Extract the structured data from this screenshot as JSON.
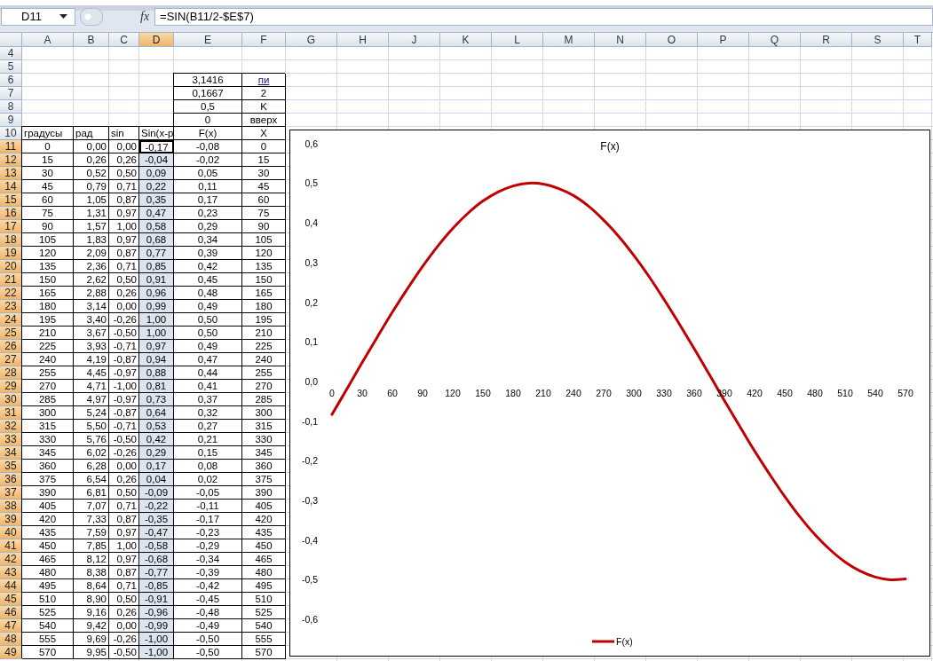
{
  "formula_bar": {
    "name_box": "D11",
    "function_label": "fx",
    "formula": "=SIN(B11/2-$E$7)"
  },
  "sheet": {
    "columns": [
      {
        "label": "A",
        "selected": false
      },
      {
        "label": "B",
        "selected": false
      },
      {
        "label": "C",
        "selected": false
      },
      {
        "label": "D",
        "selected": true
      },
      {
        "label": "E",
        "selected": false
      },
      {
        "label": "F",
        "selected": false
      },
      {
        "label": "G",
        "selected": false
      },
      {
        "label": "H",
        "selected": false
      },
      {
        "label": "J",
        "selected": false
      },
      {
        "label": "K",
        "selected": false
      },
      {
        "label": "L",
        "selected": false
      },
      {
        "label": "M",
        "selected": false
      },
      {
        "label": "N",
        "selected": false
      },
      {
        "label": "O",
        "selected": false
      },
      {
        "label": "P",
        "selected": false
      },
      {
        "label": "Q",
        "selected": false
      },
      {
        "label": "R",
        "selected": false
      },
      {
        "label": "S",
        "selected": false
      },
      {
        "label": "T",
        "selected": false
      }
    ],
    "rows": [
      {
        "number": "4",
        "kind": "blank",
        "selected": false
      },
      {
        "number": "5",
        "kind": "blank",
        "selected": false
      },
      {
        "number": "6",
        "kind": "param",
        "selected": false,
        "e": "3,1416",
        "f": "пи",
        "f_underlined": true
      },
      {
        "number": "7",
        "kind": "param",
        "selected": false,
        "e": "0,1667",
        "f": "2",
        "f_underlined": false
      },
      {
        "number": "8",
        "kind": "param",
        "selected": false,
        "e": "0,5",
        "f": "K",
        "f_underlined": false
      },
      {
        "number": "9",
        "kind": "param",
        "selected": false,
        "e": "0",
        "f": "вверх",
        "f_underlined": false
      },
      {
        "number": "10",
        "kind": "header",
        "selected": false,
        "values": [
          "градусы",
          "рад",
          "sin",
          "Sin(x-p",
          "F(x)",
          "X"
        ]
      },
      {
        "number": "11",
        "kind": "data",
        "selected": true,
        "values": [
          "0",
          "0,00",
          "0,00",
          "-0,17",
          "-0,08",
          "0"
        ]
      },
      {
        "number": "12",
        "kind": "data",
        "selected": true,
        "values": [
          "15",
          "0,26",
          "0,26",
          "-0,04",
          "-0,02",
          "15"
        ]
      },
      {
        "number": "13",
        "kind": "data",
        "selected": true,
        "values": [
          "30",
          "0,52",
          "0,50",
          "0,09",
          "0,05",
          "30"
        ]
      },
      {
        "number": "14",
        "kind": "data",
        "selected": true,
        "values": [
          "45",
          "0,79",
          "0,71",
          "0,22",
          "0,11",
          "45"
        ]
      },
      {
        "number": "15",
        "kind": "data",
        "selected": true,
        "values": [
          "60",
          "1,05",
          "0,87",
          "0,35",
          "0,17",
          "60"
        ]
      },
      {
        "number": "16",
        "kind": "data",
        "selected": true,
        "values": [
          "75",
          "1,31",
          "0,97",
          "0,47",
          "0,23",
          "75"
        ]
      },
      {
        "number": "17",
        "kind": "data",
        "selected": true,
        "values": [
          "90",
          "1,57",
          "1,00",
          "0,58",
          "0,29",
          "90"
        ]
      },
      {
        "number": "18",
        "kind": "data",
        "selected": true,
        "values": [
          "105",
          "1,83",
          "0,97",
          "0,68",
          "0,34",
          "105"
        ]
      },
      {
        "number": "19",
        "kind": "data",
        "selected": true,
        "values": [
          "120",
          "2,09",
          "0,87",
          "0,77",
          "0,39",
          "120"
        ]
      },
      {
        "number": "20",
        "kind": "data",
        "selected": true,
        "values": [
          "135",
          "2,36",
          "0,71",
          "0,85",
          "0,42",
          "135"
        ]
      },
      {
        "number": "21",
        "kind": "data",
        "selected": true,
        "values": [
          "150",
          "2,62",
          "0,50",
          "0,91",
          "0,45",
          "150"
        ]
      },
      {
        "number": "22",
        "kind": "data",
        "selected": true,
        "values": [
          "165",
          "2,88",
          "0,26",
          "0,96",
          "0,48",
          "165"
        ]
      },
      {
        "number": "23",
        "kind": "data",
        "selected": true,
        "values": [
          "180",
          "3,14",
          "0,00",
          "0,99",
          "0,49",
          "180"
        ]
      },
      {
        "number": "24",
        "kind": "data",
        "selected": true,
        "values": [
          "195",
          "3,40",
          "-0,26",
          "1,00",
          "0,50",
          "195"
        ]
      },
      {
        "number": "25",
        "kind": "data",
        "selected": true,
        "values": [
          "210",
          "3,67",
          "-0,50",
          "1,00",
          "0,50",
          "210"
        ]
      },
      {
        "number": "26",
        "kind": "data",
        "selected": true,
        "values": [
          "225",
          "3,93",
          "-0,71",
          "0,97",
          "0,49",
          "225"
        ]
      },
      {
        "number": "27",
        "kind": "data",
        "selected": true,
        "values": [
          "240",
          "4,19",
          "-0,87",
          "0,94",
          "0,47",
          "240"
        ]
      },
      {
        "number": "28",
        "kind": "data",
        "selected": true,
        "values": [
          "255",
          "4,45",
          "-0,97",
          "0,88",
          "0,44",
          "255"
        ]
      },
      {
        "number": "29",
        "kind": "data",
        "selected": true,
        "values": [
          "270",
          "4,71",
          "-1,00",
          "0,81",
          "0,41",
          "270"
        ]
      },
      {
        "number": "30",
        "kind": "data",
        "selected": true,
        "values": [
          "285",
          "4,97",
          "-0,97",
          "0,73",
          "0,37",
          "285"
        ]
      },
      {
        "number": "31",
        "kind": "data",
        "selected": true,
        "values": [
          "300",
          "5,24",
          "-0,87",
          "0,64",
          "0,32",
          "300"
        ]
      },
      {
        "number": "32",
        "kind": "data",
        "selected": true,
        "values": [
          "315",
          "5,50",
          "-0,71",
          "0,53",
          "0,27",
          "315"
        ]
      },
      {
        "number": "33",
        "kind": "data",
        "selected": true,
        "values": [
          "330",
          "5,76",
          "-0,50",
          "0,42",
          "0,21",
          "330"
        ]
      },
      {
        "number": "34",
        "kind": "data",
        "selected": true,
        "values": [
          "345",
          "6,02",
          "-0,26",
          "0,29",
          "0,15",
          "345"
        ]
      },
      {
        "number": "35",
        "kind": "data",
        "selected": true,
        "values": [
          "360",
          "6,28",
          "0,00",
          "0,17",
          "0,08",
          "360"
        ]
      },
      {
        "number": "36",
        "kind": "data",
        "selected": true,
        "values": [
          "375",
          "6,54",
          "0,26",
          "0,04",
          "0,02",
          "375"
        ]
      },
      {
        "number": "37",
        "kind": "data",
        "selected": true,
        "values": [
          "390",
          "6,81",
          "0,50",
          "-0,09",
          "-0,05",
          "390"
        ]
      },
      {
        "number": "38",
        "kind": "data",
        "selected": true,
        "values": [
          "405",
          "7,07",
          "0,71",
          "-0,22",
          "-0,11",
          "405"
        ]
      },
      {
        "number": "39",
        "kind": "data",
        "selected": true,
        "values": [
          "420",
          "7,33",
          "0,87",
          "-0,35",
          "-0,17",
          "420"
        ]
      },
      {
        "number": "40",
        "kind": "data",
        "selected": true,
        "values": [
          "435",
          "7,59",
          "0,97",
          "-0,47",
          "-0,23",
          "435"
        ]
      },
      {
        "number": "41",
        "kind": "data",
        "selected": true,
        "values": [
          "450",
          "7,85",
          "1,00",
          "-0,58",
          "-0,29",
          "450"
        ]
      },
      {
        "number": "42",
        "kind": "data",
        "selected": true,
        "values": [
          "465",
          "8,12",
          "0,97",
          "-0,68",
          "-0,34",
          "465"
        ]
      },
      {
        "number": "43",
        "kind": "data",
        "selected": true,
        "values": [
          "480",
          "8,38",
          "0,87",
          "-0,77",
          "-0,39",
          "480"
        ]
      },
      {
        "number": "44",
        "kind": "data",
        "selected": true,
        "values": [
          "495",
          "8,64",
          "0,71",
          "-0,85",
          "-0,42",
          "495"
        ]
      },
      {
        "number": "45",
        "kind": "data",
        "selected": true,
        "values": [
          "510",
          "8,90",
          "0,50",
          "-0,91",
          "-0,45",
          "510"
        ]
      },
      {
        "number": "46",
        "kind": "data",
        "selected": true,
        "values": [
          "525",
          "9,16",
          "0,26",
          "-0,96",
          "-0,48",
          "525"
        ]
      },
      {
        "number": "47",
        "kind": "data",
        "selected": true,
        "values": [
          "540",
          "9,42",
          "0,00",
          "-0,99",
          "-0,49",
          "540"
        ]
      },
      {
        "number": "48",
        "kind": "data",
        "selected": true,
        "values": [
          "555",
          "9,69",
          "-0,26",
          "-1,00",
          "-0,50",
          "555"
        ]
      },
      {
        "number": "49",
        "kind": "data",
        "selected": true,
        "values": [
          "570",
          "9,95",
          "-0,50",
          "-1,00",
          "-0,50",
          "570"
        ]
      }
    ]
  },
  "chart": {
    "chart_data": {
      "type": "line",
      "title": "F(x)",
      "x": [
        0,
        15,
        30,
        45,
        60,
        75,
        90,
        105,
        120,
        135,
        150,
        165,
        180,
        195,
        210,
        225,
        240,
        255,
        270,
        285,
        300,
        315,
        330,
        345,
        360,
        375,
        390,
        405,
        420,
        435,
        450,
        465,
        480,
        495,
        510,
        525,
        540,
        555,
        570
      ],
      "xlim": [
        0,
        570
      ],
      "xticks": [
        {
          "value": 0,
          "label": "0"
        },
        {
          "value": 30,
          "label": "30"
        },
        {
          "value": 60,
          "label": "60"
        },
        {
          "value": 90,
          "label": "90"
        },
        {
          "value": 120,
          "label": "120"
        },
        {
          "value": 150,
          "label": "150"
        },
        {
          "value": 180,
          "label": "180"
        },
        {
          "value": 210,
          "label": "210"
        },
        {
          "value": 240,
          "label": "240"
        },
        {
          "value": 270,
          "label": "270"
        },
        {
          "value": 300,
          "label": "300"
        },
        {
          "value": 330,
          "label": "330"
        },
        {
          "value": 360,
          "label": "360"
        },
        {
          "value": 390,
          "label": "390"
        },
        {
          "value": 420,
          "label": "420"
        },
        {
          "value": 450,
          "label": "450"
        },
        {
          "value": 480,
          "label": "480"
        },
        {
          "value": 510,
          "label": "510"
        },
        {
          "value": 540,
          "label": "540"
        },
        {
          "value": 570,
          "label": "570"
        }
      ],
      "ylim": [
        -0.6,
        0.6
      ],
      "yticks": [
        {
          "value": 0.6,
          "label": "0,6"
        },
        {
          "value": 0.5,
          "label": "0,5"
        },
        {
          "value": 0.4,
          "label": "0,4"
        },
        {
          "value": 0.3,
          "label": "0,3"
        },
        {
          "value": 0.2,
          "label": "0,2"
        },
        {
          "value": 0.1,
          "label": "0,1"
        },
        {
          "value": 0,
          "label": "0,0"
        },
        {
          "value": -0.1,
          "label": "-0,1"
        },
        {
          "value": -0.2,
          "label": "-0,2"
        },
        {
          "value": -0.3,
          "label": "-0,3"
        },
        {
          "value": -0.4,
          "label": "-0,4"
        },
        {
          "value": -0.5,
          "label": "-0,5"
        },
        {
          "value": -0.6,
          "label": "-0,6"
        }
      ],
      "series": [
        {
          "name": "F(x)",
          "color": "#c00000",
          "values": [
            -0.083,
            -0.018,
            0.048,
            0.112,
            0.175,
            0.234,
            0.29,
            0.341,
            0.386,
            0.424,
            0.455,
            0.478,
            0.493,
            0.5,
            0.498,
            0.487,
            0.469,
            0.442,
            0.407,
            0.366,
            0.318,
            0.265,
            0.207,
            0.146,
            0.083,
            0.018,
            -0.048,
            -0.112,
            -0.175,
            -0.234,
            -0.29,
            -0.341,
            -0.386,
            -0.424,
            -0.455,
            -0.478,
            -0.493,
            -0.5,
            -0.498
          ]
        }
      ]
    }
  }
}
